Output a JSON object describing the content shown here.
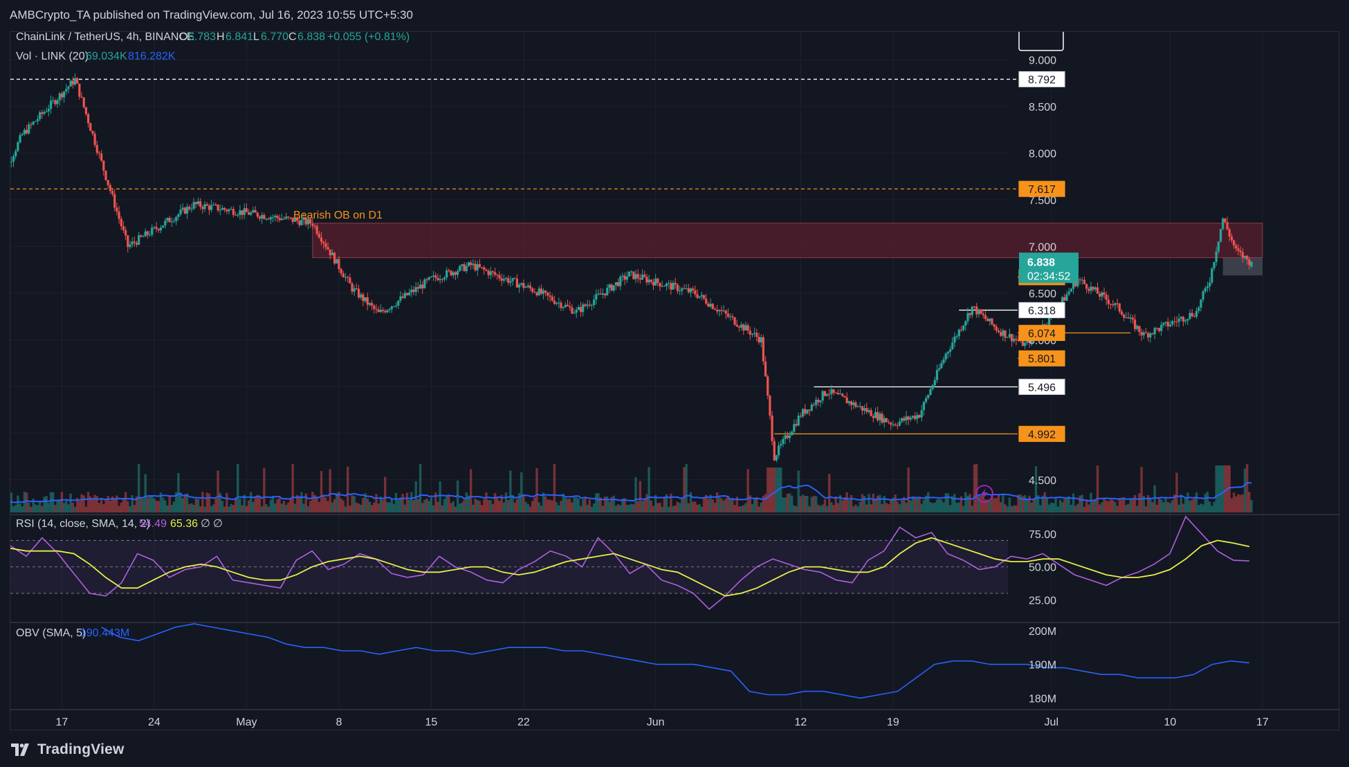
{
  "header": {
    "publisher": "AMBCrypto_TA published on TradingView.com, Jul 16, 2023 10:55 UTC+5:30"
  },
  "legend": {
    "symbol": "ChainLink / TetherUS, 4h, BINANCE",
    "o_label": "O",
    "o": "6.783",
    "h_label": "H",
    "h": "6.841",
    "l_label": "L",
    "l": "6.770",
    "c_label": "C",
    "c": "6.838",
    "change": "+0.055 (+0.81%)",
    "vol_label": "Vol · LINK (20)",
    "vol_value": "69.034K",
    "vol_ma": "816.282K"
  },
  "rsi_legend": {
    "label": "RSI (14, close, SMA, 14, 2)",
    "rsi": "54.49",
    "sma": "65.36",
    "extra1": "∅",
    "extra2": "∅"
  },
  "obv_legend": {
    "label": "OBV (SMA, 5)",
    "value": "190.443M"
  },
  "annotation": {
    "text": "Bearish OB on D1"
  },
  "price_badges": {
    "top_level": "8.792",
    "resistance": "7.617",
    "last_price": "6.838",
    "countdown": "02:34:52",
    "level_6671": "6.671",
    "level_6318": "6.318",
    "level_6074": "6.074",
    "level_5801": "5.801",
    "level_5496": "5.496",
    "level_4992": "4.992"
  },
  "footer": {
    "brand": "TradingView"
  },
  "colors": {
    "background": "#131722",
    "up": "#26a69a",
    "down": "#ef5350",
    "orange": "#f7931a",
    "volume_ma": "#2962ff",
    "rsi_line": "#b060e0",
    "rsi_sma": "#e8f04a",
    "obv_line": "#2962ff",
    "ob_zone": "#5a1f2e"
  },
  "chart_data": [
    {
      "type": "candlestick",
      "pane": "price",
      "title": "ChainLink / TetherUS, 4h, BINANCE",
      "interval": "4h",
      "y_axis": {
        "ticks": [
          "4.500",
          "5.000",
          "5.500",
          "6.000",
          "6.500",
          "7.000",
          "7.500",
          "8.000",
          "8.500",
          "9.000"
        ],
        "ylim": [
          4.15,
          9.3
        ]
      },
      "x_axis": {
        "ticks": [
          "17",
          "24",
          "May",
          "8",
          "15",
          "22",
          "Jun",
          "12",
          "19",
          "Jul",
          "10",
          "17"
        ]
      },
      "key_prices": [
        {
          "date": "Apr 12",
          "price": 7.6
        },
        {
          "date": "Apr 14",
          "price": 8.2
        },
        {
          "date": "Apr 18",
          "price": 8.79
        },
        {
          "date": "Apr 20",
          "price": 7.9
        },
        {
          "date": "Apr 22",
          "price": 7.0
        },
        {
          "date": "Apr 27",
          "price": 7.45
        },
        {
          "date": "May 6",
          "price": 7.25
        },
        {
          "date": "May 9",
          "price": 6.55
        },
        {
          "date": "May 11",
          "price": 6.28
        },
        {
          "date": "May 15",
          "price": 6.65
        },
        {
          "date": "May 18",
          "price": 6.8
        },
        {
          "date": "May 23",
          "price": 6.52
        },
        {
          "date": "May 26",
          "price": 6.3
        },
        {
          "date": "May 30",
          "price": 6.7
        },
        {
          "date": "Jun 4",
          "price": 6.5
        },
        {
          "date": "Jun 7",
          "price": 6.2
        },
        {
          "date": "Jun 9",
          "price": 6.0
        },
        {
          "date": "Jun 10",
          "price": 4.75
        },
        {
          "date": "Jun 12",
          "price": 5.2
        },
        {
          "date": "Jun 14",
          "price": 5.45
        },
        {
          "date": "Jun 19",
          "price": 5.1
        },
        {
          "date": "Jun 21",
          "price": 5.2
        },
        {
          "date": "Jun 23",
          "price": 5.85
        },
        {
          "date": "Jun 25",
          "price": 6.35
        },
        {
          "date": "Jun 27",
          "price": 6.1
        },
        {
          "date": "Jun 29",
          "price": 5.95
        },
        {
          "date": "Jul 1",
          "price": 6.25
        },
        {
          "date": "Jul 3",
          "price": 6.65
        },
        {
          "date": "Jul 6",
          "price": 6.35
        },
        {
          "date": "Jul 8",
          "price": 6.05
        },
        {
          "date": "Jul 12",
          "price": 6.3
        },
        {
          "date": "Jul 13",
          "price": 6.65
        },
        {
          "date": "Jul 14",
          "price": 7.3
        },
        {
          "date": "Jul 15",
          "price": 6.95
        },
        {
          "date": "Jul 16",
          "price": 6.84
        }
      ],
      "levels": [
        {
          "price": 8.792,
          "style": "dashed",
          "color": "#ffffff"
        },
        {
          "price": 7.617,
          "style": "dashed",
          "color": "#f7931a"
        },
        {
          "price": 6.671,
          "style": "solid",
          "color": "#f7931a"
        },
        {
          "price": 6.318,
          "style": "solid",
          "color": "#ffffff"
        },
        {
          "price": 6.074,
          "style": "solid",
          "color": "#f7931a"
        },
        {
          "price": 5.801,
          "style": "solid",
          "color": "#f7931a"
        },
        {
          "price": 5.496,
          "style": "solid",
          "color": "#ffffff"
        },
        {
          "price": 4.992,
          "style": "solid",
          "color": "#f7931a"
        }
      ],
      "zones": [
        {
          "label": "Bearish OB on D1",
          "from": "May 6",
          "to": "Jul 17",
          "top": 7.25,
          "bottom": 6.88
        }
      ]
    },
    {
      "type": "line",
      "pane": "rsi",
      "title": "RSI (14, close, SMA, 14, 2)",
      "y_axis": {
        "ticks": [
          "25.00",
          "50.00",
          "75.00"
        ],
        "ylim": [
          9,
          88
        ]
      },
      "bands": [
        30,
        50,
        70
      ],
      "series": [
        {
          "values": [
            66,
            58,
            72,
            60,
            45,
            30,
            28,
            38,
            60,
            55,
            42,
            48,
            50,
            58,
            40,
            38,
            36,
            34,
            55,
            62,
            48,
            52,
            60,
            56,
            45,
            42,
            44,
            58,
            50,
            46,
            40,
            38,
            48,
            54,
            62,
            58,
            50,
            72,
            60,
            45,
            52,
            40,
            36,
            30,
            18,
            28,
            40,
            50,
            56,
            52,
            48,
            46,
            40,
            38,
            55,
            62,
            80,
            72,
            76,
            60,
            55,
            48,
            50,
            58,
            56,
            60,
            52,
            44,
            40,
            36,
            42,
            46,
            52,
            60,
            88,
            75,
            62,
            55,
            54.49
          ]
        },
        {
          "values": [
            64,
            62,
            62,
            62,
            60,
            52,
            42,
            34,
            34,
            40,
            46,
            50,
            52,
            50,
            46,
            42,
            40,
            40,
            44,
            50,
            54,
            56,
            58,
            56,
            52,
            48,
            46,
            46,
            48,
            50,
            50,
            46,
            44,
            46,
            50,
            54,
            56,
            58,
            60,
            56,
            52,
            48,
            46,
            40,
            34,
            28,
            30,
            34,
            40,
            46,
            50,
            50,
            48,
            46,
            46,
            50,
            60,
            68,
            72,
            68,
            64,
            60,
            56,
            54,
            54,
            56,
            56,
            52,
            48,
            44,
            42,
            42,
            44,
            48,
            56,
            66,
            70,
            68,
            65.36
          ]
        }
      ]
    },
    {
      "type": "line",
      "pane": "obv",
      "title": "OBV (SMA, 5)",
      "y_axis": {
        "ticks": [
          "180M",
          "190M",
          "200M"
        ],
        "ylim": [
          177,
          202
        ]
      },
      "series": [
        {
          "values": [
            201,
            198,
            197,
            199,
            201,
            202,
            201,
            200,
            199,
            198,
            196,
            195,
            195,
            194,
            194,
            193,
            194,
            195,
            194,
            194,
            193,
            194,
            195,
            195,
            195,
            194,
            194,
            193,
            192,
            191,
            190,
            190,
            190,
            189,
            188,
            182,
            181,
            181,
            182,
            182,
            181,
            180,
            181,
            182,
            186,
            190,
            191,
            191,
            190,
            190,
            190,
            189,
            189,
            188,
            187,
            187,
            186,
            186,
            186,
            187,
            190,
            191,
            190.443
          ]
        }
      ]
    }
  ]
}
